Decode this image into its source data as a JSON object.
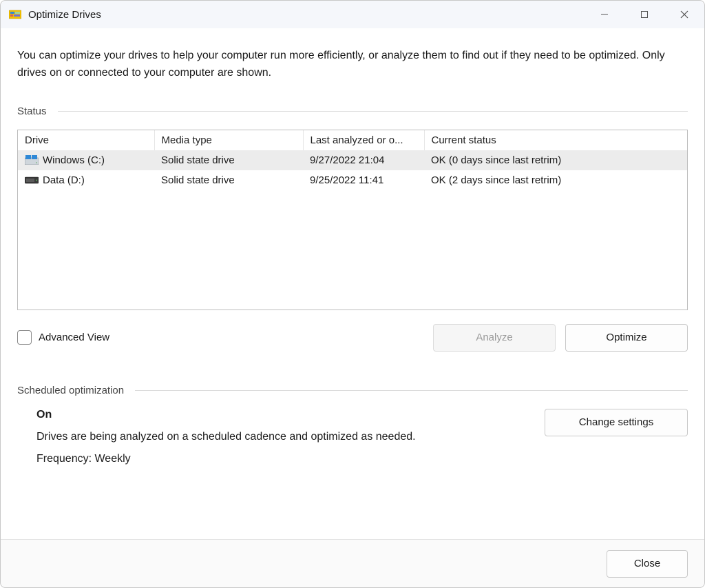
{
  "window": {
    "title": "Optimize Drives"
  },
  "intro": "You can optimize your drives to help your computer run more efficiently, or analyze them to find out if they need to be optimized. Only drives on or connected to your computer are shown.",
  "status": {
    "label": "Status",
    "columns": {
      "drive": "Drive",
      "media_type": "Media type",
      "last_analyzed": "Last analyzed or o...",
      "current_status": "Current status"
    },
    "rows": [
      {
        "drive": "Windows  (C:)",
        "media_type": "Solid state drive",
        "last_analyzed": "9/27/2022 21:04",
        "current_status": "OK (0 days since last retrim)",
        "selected": true,
        "icon": "windows"
      },
      {
        "drive": "Data (D:)",
        "media_type": "Solid state drive",
        "last_analyzed": "9/25/2022 11:41",
        "current_status": "OK (2 days since last retrim)",
        "selected": false,
        "icon": "hdd"
      }
    ]
  },
  "advanced_view_label": "Advanced View",
  "buttons": {
    "analyze": "Analyze",
    "optimize": "Optimize",
    "change_settings": "Change settings",
    "close": "Close"
  },
  "scheduled": {
    "label": "Scheduled optimization",
    "state": "On",
    "desc": "Drives are being analyzed on a scheduled cadence and optimized as needed.",
    "frequency": "Frequency: Weekly"
  }
}
